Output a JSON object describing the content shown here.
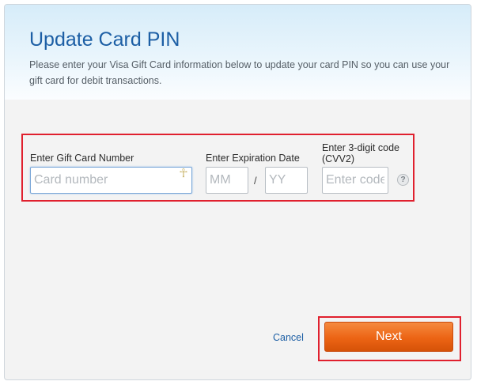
{
  "header": {
    "title": "Update Card PIN",
    "description": "Please enter your Visa Gift Card information below to update your card PIN so you can use your gift card for debit transactions."
  },
  "form": {
    "card_number": {
      "label": "Enter Gift Card Number",
      "placeholder": "Card number",
      "value": ""
    },
    "expiration": {
      "label": "Enter Expiration Date",
      "month_placeholder": "MM",
      "year_placeholder": "YY",
      "separator": "/"
    },
    "cvv": {
      "label": "Enter 3-digit code (CVV2)",
      "placeholder": "Enter code",
      "help": "?"
    }
  },
  "actions": {
    "cancel_label": "Cancel",
    "next_label": "Next"
  },
  "colors": {
    "title": "#1d5fa5",
    "highlight_border": "#e0202e",
    "next_button": "#ec6414",
    "background": "#f3f3f3"
  }
}
